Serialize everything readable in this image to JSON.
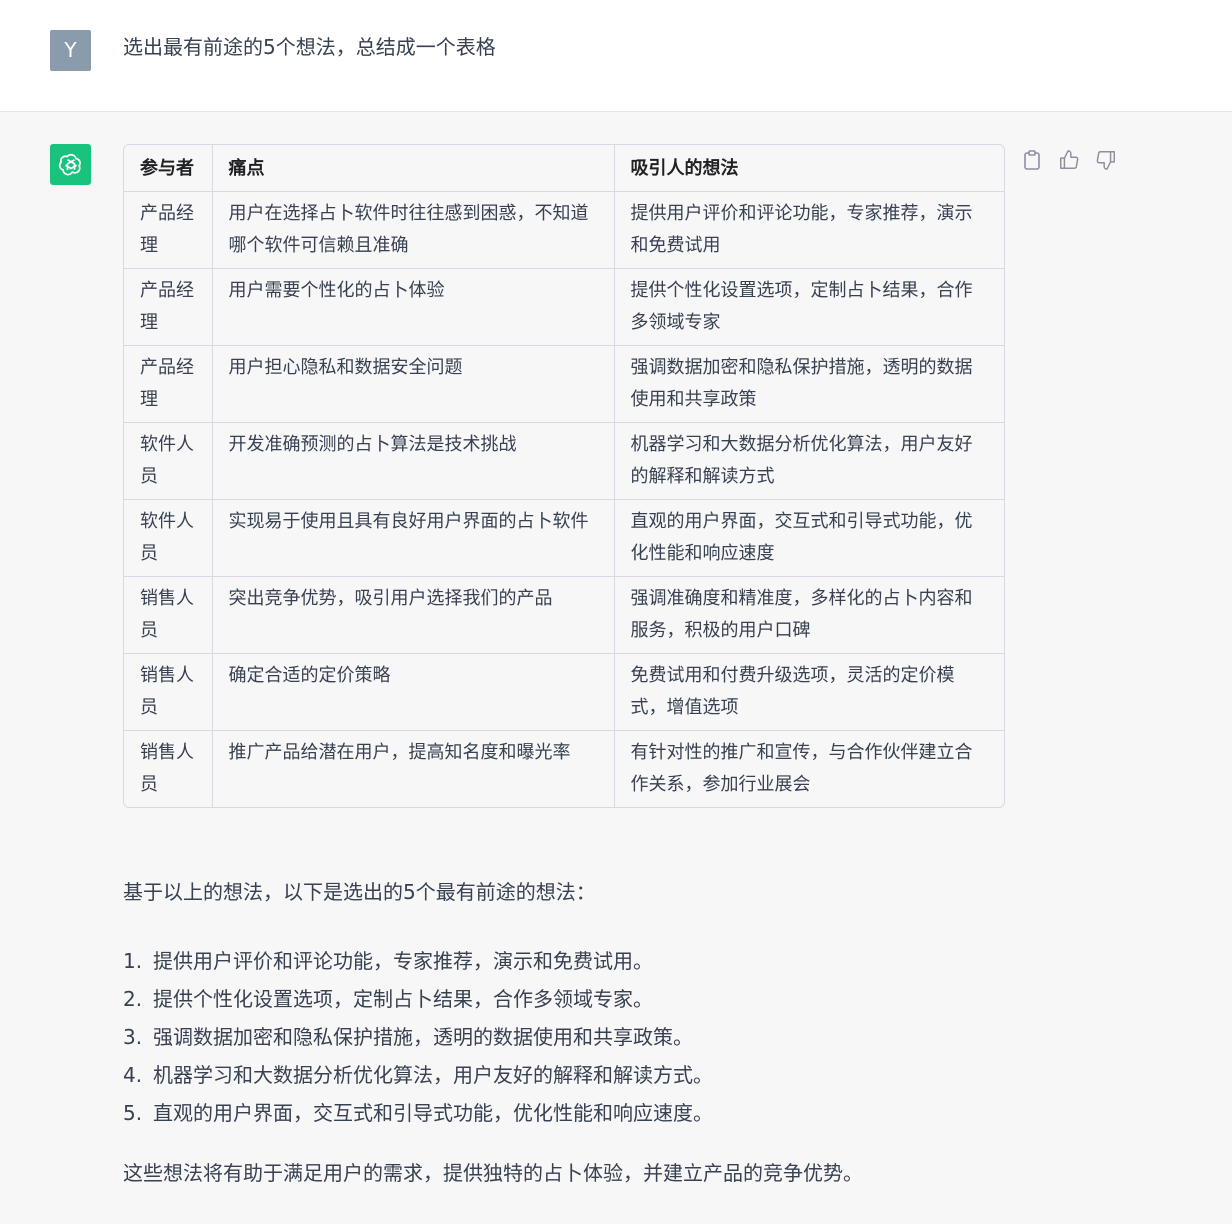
{
  "user_message": {
    "avatar_letter": "Y",
    "text": "选出最有前途的5个想法，总结成一个表格"
  },
  "assistant": {
    "table": {
      "headers": [
        "参与者",
        "痛点",
        "吸引人的想法"
      ],
      "rows": [
        [
          "产品经理",
          "用户在选择占卜软件时往往感到困惑，不知道哪个软件可信赖且准确",
          "提供用户评价和评论功能，专家推荐，演示和免费试用"
        ],
        [
          "产品经理",
          "用户需要个性化的占卜体验",
          "提供个性化设置选项，定制占卜结果，合作多领域专家"
        ],
        [
          "产品经理",
          "用户担心隐私和数据安全问题",
          "强调数据加密和隐私保护措施，透明的数据使用和共享政策"
        ],
        [
          "软件人员",
          "开发准确预测的占卜算法是技术挑战",
          "机器学习和大数据分析优化算法，用户友好的解释和解读方式"
        ],
        [
          "软件人员",
          "实现易于使用且具有良好用户界面的占卜软件",
          "直观的用户界面，交互式和引导式功能，优化性能和响应速度"
        ],
        [
          "销售人员",
          "突出竞争优势，吸引用户选择我们的产品",
          "强调准确度和精准度，多样化的占卜内容和服务，积极的用户口碑"
        ],
        [
          "销售人员",
          "确定合适的定价策略",
          "免费试用和付费升级选项，灵活的定价模式，增值选项"
        ],
        [
          "销售人员",
          "推广产品给潜在用户，提高知名度和曝光率",
          "有针对性的推广和宣传，与合作伙伴建立合作关系，参加行业展会"
        ]
      ]
    },
    "intro": "基于以上的想法，以下是选出的5个最有前途的想法：",
    "ideas": [
      {
        "num": "1.",
        "text": "提供用户评价和评论功能，专家推荐，演示和免费试用。"
      },
      {
        "num": "2.",
        "text": "提供个性化设置选项，定制占卜结果，合作多领域专家。"
      },
      {
        "num": "3.",
        "text": "强调数据加密和隐私保护措施，透明的数据使用和共享政策。"
      },
      {
        "num": "4.",
        "text": "机器学习和大数据分析优化算法，用户友好的解释和解读方式。"
      },
      {
        "num": "5.",
        "text": "直观的用户界面，交互式和引导式功能，优化性能和响应速度。"
      }
    ],
    "conclusion": "这些想法将有助于满足用户的需求，提供独特的占卜体验，并建立产品的竞争优势。",
    "actions": [
      "copy-icon",
      "thumbs-up-icon",
      "thumbs-down-icon"
    ]
  },
  "colors": {
    "page_bg": "#f7f7f8",
    "user_bg": "#ffffff",
    "user_avatar": "#8a9bab",
    "bot_avatar": "#19c37d",
    "text": "#374151",
    "border": "#d9d9e3"
  }
}
